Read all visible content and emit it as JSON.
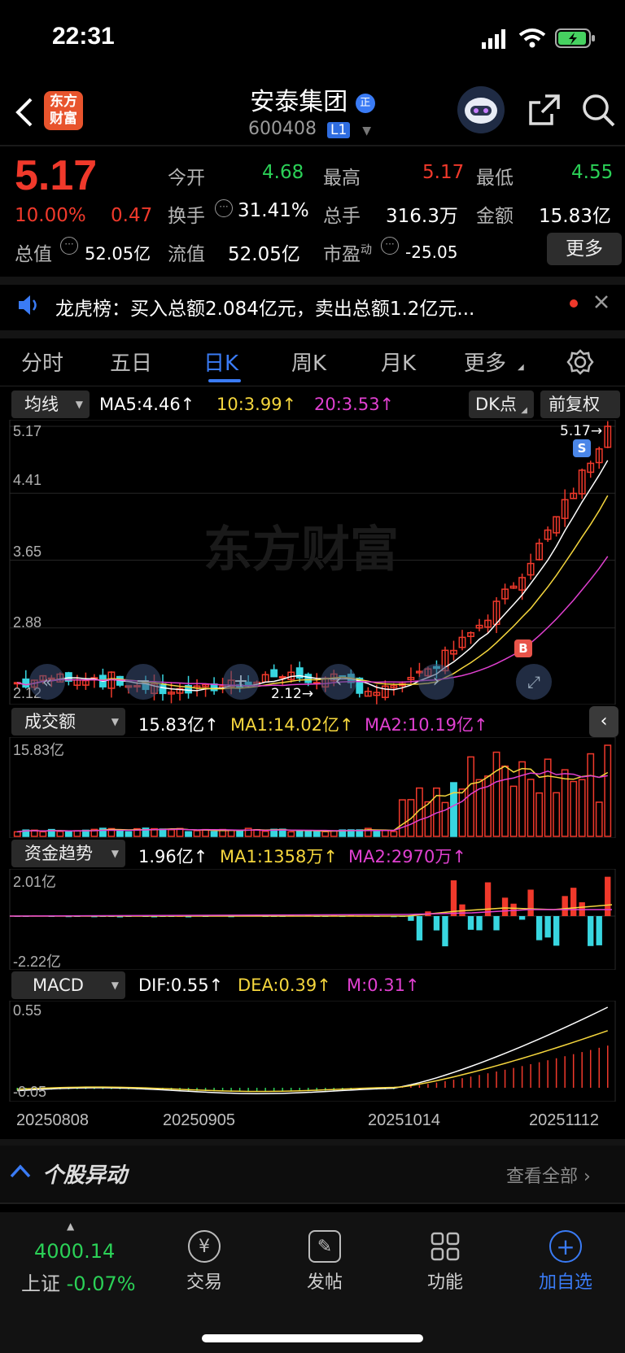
{
  "status": {
    "time": "22:31"
  },
  "header": {
    "logo_line1": "东方",
    "logo_line2": "财富",
    "title": "安泰集团",
    "title_badge": "正",
    "code": "600408",
    "level": "L1"
  },
  "quote": {
    "price": "5.17",
    "change_pct": "10.00%",
    "change": "0.47",
    "open_label": "今开",
    "open": "4.68",
    "high_label": "最高",
    "high": "5.17",
    "low_label": "最低",
    "low": "4.55",
    "turnover_label": "换手",
    "turnover": "31.41%",
    "volume_label": "总手",
    "volume": "316.3万",
    "amount_label": "金额",
    "amount": "15.83亿",
    "total_mv_label": "总值",
    "total_mv": "52.05亿",
    "float_mv_label": "流值",
    "float_mv": "52.05亿",
    "pe_label": "市盈",
    "pe_sup": "动",
    "pe": "-25.05",
    "more_label": "更多"
  },
  "news": {
    "text": "龙虎榜：买入总额2.084亿元，卖出总额1.2亿元..."
  },
  "tabs": [
    "分时",
    "五日",
    "日K",
    "周K",
    "月K",
    "更多"
  ],
  "active_tab": "日K",
  "chart_controls": {
    "ma_select": "均线",
    "ma5": "MA5:4.46↑",
    "ma10": "10:3.99↑",
    "ma20": "20:3.53↑",
    "dk_button": "DK点",
    "adjust_button": "前复权",
    "watermark": "东方财富",
    "last_price_label": "5.17→",
    "low_price_label": "2.12→",
    "sell_marker": "S",
    "buy_marker": "B"
  },
  "volume_panel": {
    "select": "成交额",
    "value": "15.83亿↑",
    "ma1": "MA1:14.02亿↑",
    "ma2": "MA2:10.19亿↑",
    "axis_top": "15.83亿"
  },
  "fund_panel": {
    "select": "资金趋势",
    "value": "1.96亿↑",
    "ma1": "MA1:1358万↑",
    "ma2": "MA2:2970万↑",
    "axis_top": "2.01亿",
    "axis_bottom": "-2.22亿"
  },
  "macd_panel": {
    "select": "MACD",
    "dif": "DIF:0.55↑",
    "dea": "DEA:0.39↑",
    "m": "M:0.31↑",
    "axis_top": "0.55",
    "axis_bottom": "-0.05"
  },
  "dates": [
    "20250808",
    "20250905",
    "20251014",
    "20251112"
  ],
  "stock_alert": {
    "title": "个股异动",
    "view_all": "查看全部"
  },
  "bottom_nav": {
    "index_value": "4000.14",
    "index_name": "上证",
    "index_change": "-0.07%",
    "items": [
      "交易",
      "发帖",
      "功能",
      "加自选"
    ]
  },
  "colors": {
    "up": "#f0392b",
    "down": "#2bd157",
    "bear_candle": "#38d6e0",
    "ma5": "#ffffff",
    "ma10": "#f5d63d",
    "ma20": "#e040d0",
    "accent": "#3a7bf5"
  },
  "chart_data": [
    {
      "type": "candlestick",
      "title": "日K",
      "y_ticks": [
        "5.17",
        "4.41",
        "3.65",
        "2.88",
        "2.12"
      ],
      "ylim": [
        2.12,
        5.17
      ],
      "x_ticks": [
        "20250808",
        "20250905",
        "20251014",
        "20251112"
      ],
      "last_close": 5.17,
      "period_low": 2.12,
      "moving_averages": {
        "MA5": 4.46,
        "MA10": 3.99,
        "MA20": 3.53
      }
    },
    {
      "type": "bar",
      "title": "成交额",
      "ylim_top": "15.83亿",
      "latest": "15.83亿"
    },
    {
      "type": "bar",
      "title": "资金趋势",
      "ylim": [
        "-2.22亿",
        "2.01亿"
      ],
      "latest": "1.96亿"
    },
    {
      "type": "line",
      "title": "MACD",
      "ylim": [
        -0.05,
        0.55
      ],
      "DIF": 0.55,
      "DEA": 0.39,
      "M": 0.31
    }
  ]
}
